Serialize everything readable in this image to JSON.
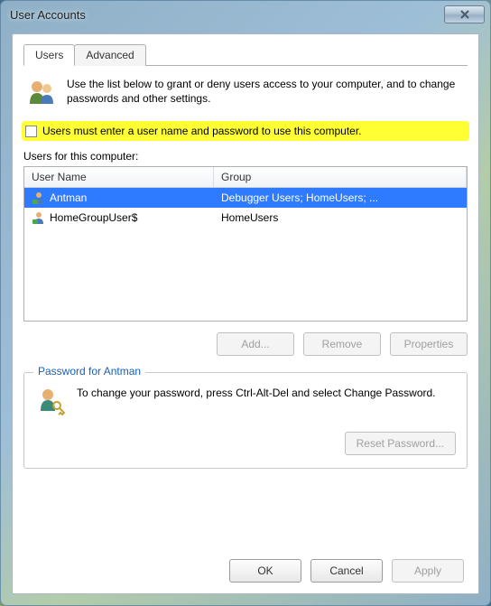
{
  "window": {
    "title": "User Accounts"
  },
  "tabs": {
    "users": "Users",
    "advanced": "Advanced"
  },
  "intro": "Use the list below to grant or deny users access to your computer, and to change passwords and other settings.",
  "checkbox_label": "Users must enter a user name and password to use this computer.",
  "users_for_label": "Users for this computer:",
  "columns": {
    "user": "User Name",
    "group": "Group"
  },
  "rows": [
    {
      "user": "Antman",
      "group": "Debugger Users; HomeUsers; ...",
      "selected": true
    },
    {
      "user": "HomeGroupUser$",
      "group": "HomeUsers",
      "selected": false
    }
  ],
  "buttons": {
    "add": "Add...",
    "remove": "Remove",
    "properties": "Properties",
    "reset_pw": "Reset Password...",
    "ok": "OK",
    "cancel": "Cancel",
    "apply": "Apply"
  },
  "password_box": {
    "title": "Password for Antman",
    "text": "To change your password, press Ctrl-Alt-Del and select Change Password."
  }
}
